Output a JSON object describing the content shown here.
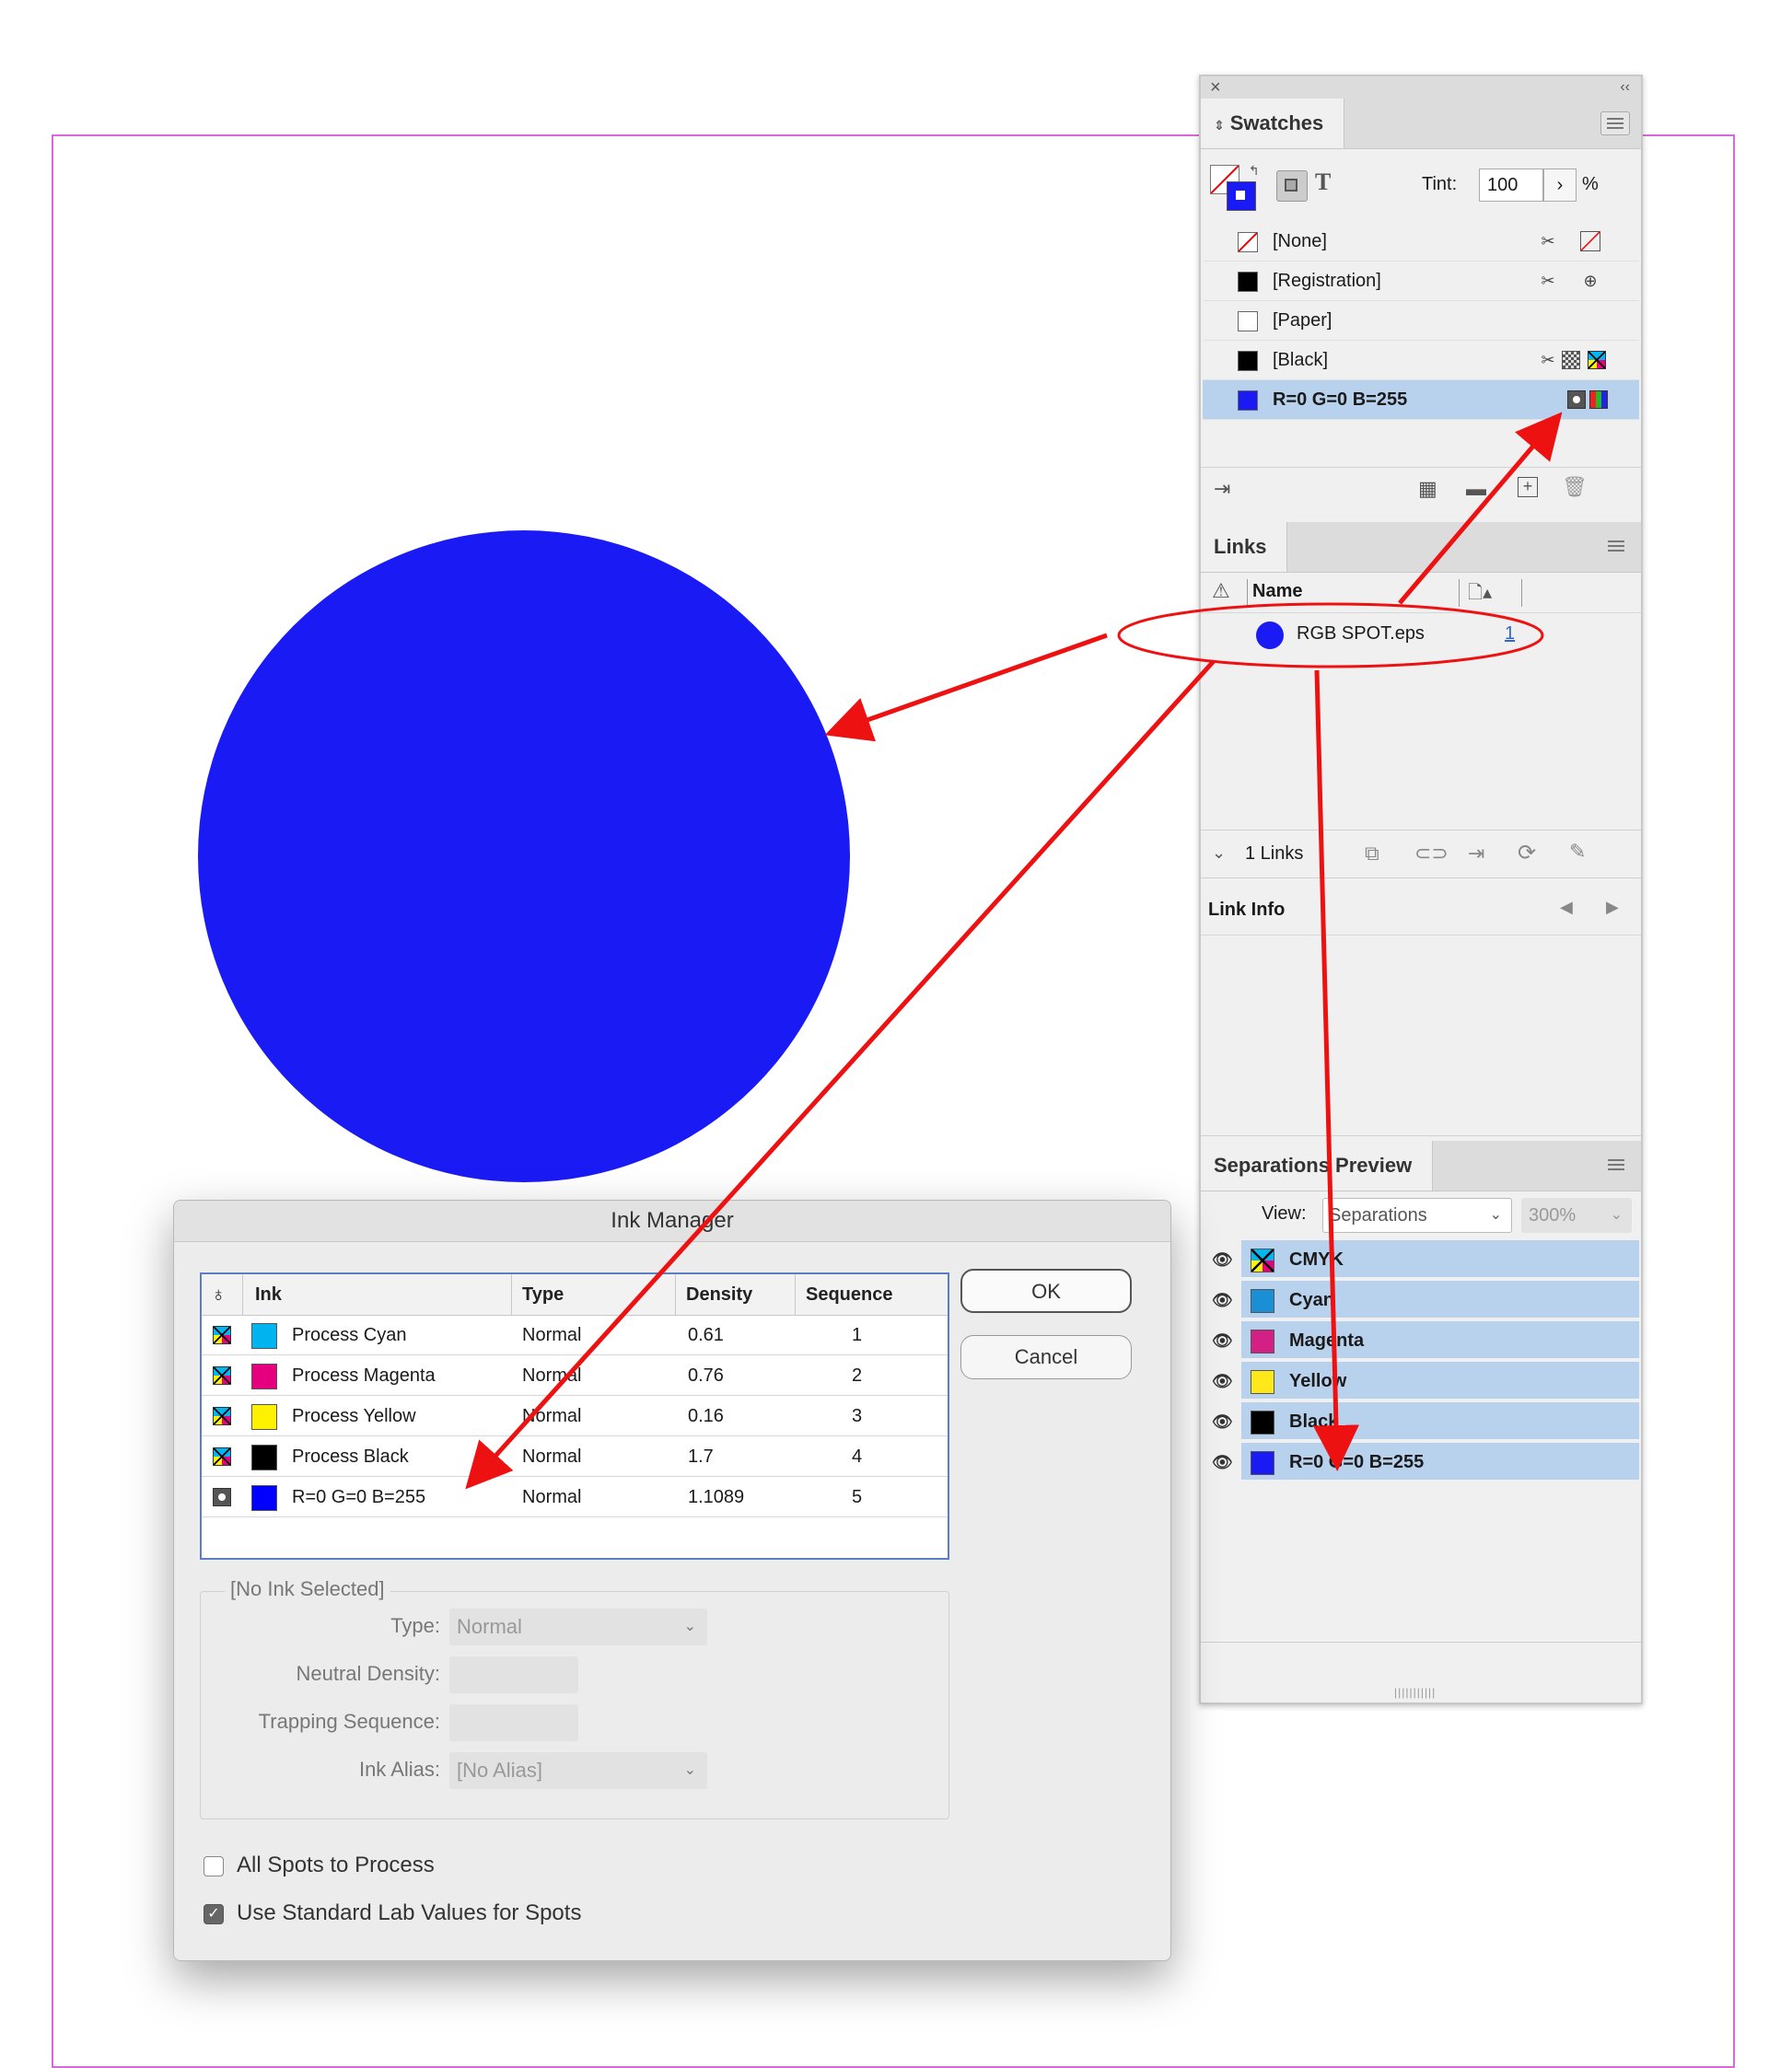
{
  "swatches": {
    "tab_label": "Swatches",
    "tint_label": "Tint:",
    "tint_value": "100",
    "tint_unit": "%",
    "items": [
      {
        "name": "[None]",
        "color": "none"
      },
      {
        "name": "[Registration]",
        "color": "#000000"
      },
      {
        "name": "[Paper]",
        "color": "#ffffff"
      },
      {
        "name": "[Black]",
        "color": "#000000"
      },
      {
        "name": "R=0 G=0 B=255",
        "color": "#1a1af5"
      }
    ]
  },
  "links": {
    "tab_label": "Links",
    "col_name": "Name",
    "file_name": "RGB SPOT.eps",
    "file_page": "1",
    "count_label": "1 Links",
    "link_info_label": "Link Info"
  },
  "separations": {
    "tab_label": "Separations Preview",
    "view_label": "View:",
    "view_value": "Separations",
    "zoom_value": "300%",
    "items": [
      {
        "name": "CMYK",
        "color": "cmyk"
      },
      {
        "name": "Cyan",
        "color": "#1a8fd6"
      },
      {
        "name": "Magenta",
        "color": "#d41f84"
      },
      {
        "name": "Yellow",
        "color": "#ffe81a"
      },
      {
        "name": "Black",
        "color": "#000000"
      },
      {
        "name": "R=0 G=0 B=255",
        "color": "#1a1af5"
      }
    ]
  },
  "ink_manager": {
    "title": "Ink Manager",
    "headers": {
      "ink": "Ink",
      "type": "Type",
      "density": "Density",
      "sequence": "Sequence"
    },
    "rows": [
      {
        "ink": "Process Cyan",
        "type": "Normal",
        "density": "0.61",
        "sequence": "1",
        "color": "#00b4ef",
        "kind": "process"
      },
      {
        "ink": "Process Magenta",
        "type": "Normal",
        "density": "0.76",
        "sequence": "2",
        "color": "#e5007e",
        "kind": "process"
      },
      {
        "ink": "Process Yellow",
        "type": "Normal",
        "density": "0.16",
        "sequence": "3",
        "color": "#fff200",
        "kind": "process"
      },
      {
        "ink": "Process Black",
        "type": "Normal",
        "density": "1.7",
        "sequence": "4",
        "color": "#000000",
        "kind": "process"
      },
      {
        "ink": "R=0 G=0 B=255",
        "type": "Normal",
        "density": "1.1089",
        "sequence": "5",
        "color": "#0000ff",
        "kind": "spot"
      }
    ],
    "ok_label": "OK",
    "cancel_label": "Cancel",
    "no_ink_label": "[No Ink Selected]",
    "type_label": "Type:",
    "type_value": "Normal",
    "neutral_density_label": "Neutral Density:",
    "trapping_sequence_label": "Trapping Sequence:",
    "ink_alias_label": "Ink Alias:",
    "ink_alias_value": "[No Alias]",
    "all_spots_label": "All Spots to Process",
    "all_spots_checked": false,
    "std_lab_label": "Use Standard Lab Values for Spots",
    "std_lab_checked": true
  },
  "colors": {
    "accent_blue": "#1a1af5",
    "selection": "#b8d2ee",
    "annotation_red": "#ee1111",
    "page_frame": "#d86ad8"
  }
}
